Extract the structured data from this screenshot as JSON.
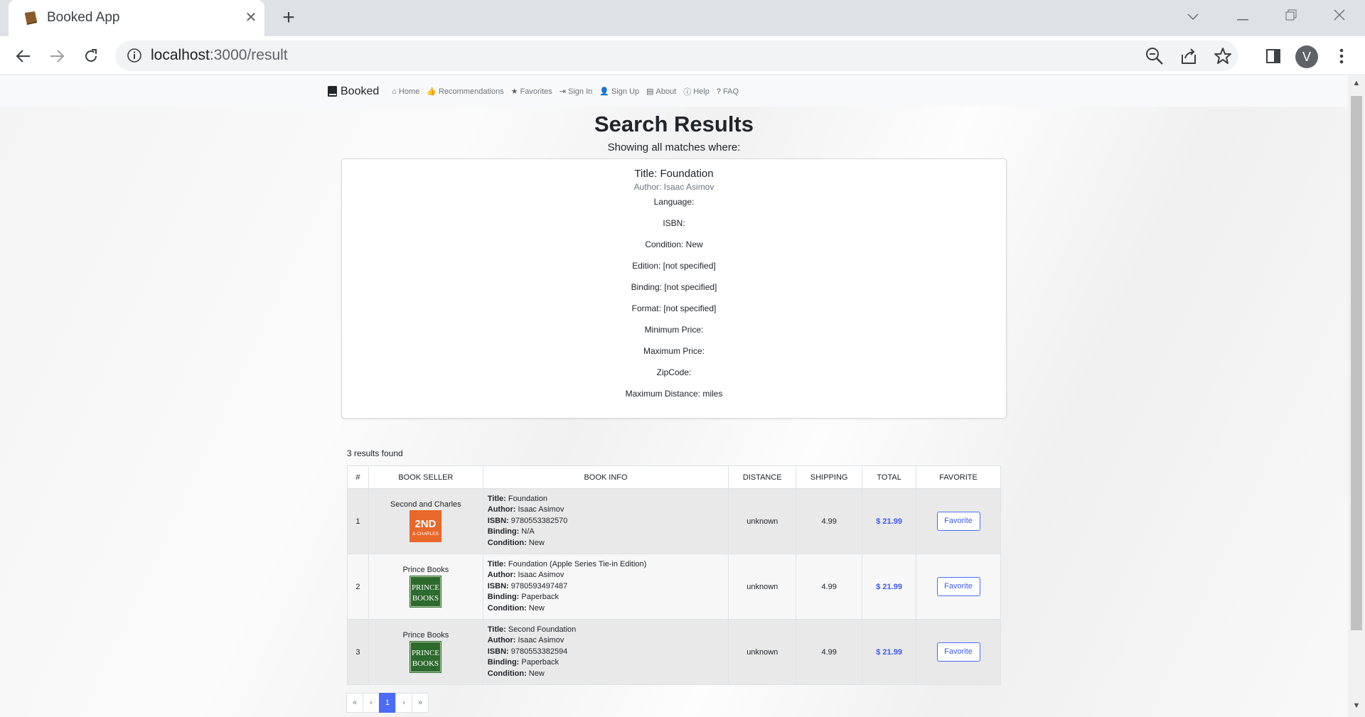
{
  "browser": {
    "tab_title": "Booked App",
    "url_host": "localhost",
    "url_rest": ":3000/result",
    "avatar_letter": "V"
  },
  "nav": {
    "brand": "Booked",
    "links": [
      {
        "label": "Home",
        "icon": "home-icon"
      },
      {
        "label": "Recommendations",
        "icon": "thumbs-up-icon"
      },
      {
        "label": "Favorites",
        "icon": "star-icon"
      },
      {
        "label": "Sign In",
        "icon": "sign-in-icon"
      },
      {
        "label": "Sign Up",
        "icon": "user-plus-icon"
      },
      {
        "label": "About",
        "icon": "id-card-icon"
      },
      {
        "label": "Help",
        "icon": "info-icon"
      },
      {
        "label": "FAQ",
        "icon": "question-icon"
      }
    ]
  },
  "page": {
    "title": "Search Results",
    "subtitle": "Showing all matches where:"
  },
  "criteria": {
    "title": "Title: Foundation",
    "author": "Author: Isaac Asimov",
    "rows": [
      "Language:",
      "ISBN:",
      "Condition: New",
      "Edition: [not specified]",
      "Binding: [not specified]",
      "Format: [not specified]",
      "Minimum Price:",
      "Maximum Price:",
      "ZipCode:",
      "Maximum Distance: miles"
    ]
  },
  "results": {
    "count_text": "3 results found",
    "headers": [
      "#",
      "BOOK SELLER",
      "BOOK INFO",
      "DISTANCE",
      "SHIPPING",
      "TOTAL",
      "FAVORITE"
    ],
    "info_labels": {
      "title": "Title:",
      "author": "Author:",
      "isbn": "ISBN:",
      "binding": "Binding:",
      "condition": "Condition:"
    },
    "rows": [
      {
        "num": "1",
        "seller": "Second and Charles",
        "logo": "second-and-charles-logo",
        "title": "Foundation",
        "author": "Isaac Asimov",
        "isbn": "9780553382570",
        "binding": "N/A",
        "condition": "New",
        "distance": "unknown",
        "shipping": "4.99",
        "total": "$ 21.99",
        "fav": "Favorite"
      },
      {
        "num": "2",
        "seller": "Prince Books",
        "logo": "prince-books-logo",
        "title": "Foundation (Apple Series Tie-in Edition)",
        "author": "Isaac Asimov",
        "isbn": "9780593497487",
        "binding": "Paperback",
        "condition": "New",
        "distance": "unknown",
        "shipping": "4.99",
        "total": "$ 21.99",
        "fav": "Favorite"
      },
      {
        "num": "3",
        "seller": "Prince Books",
        "logo": "prince-books-logo",
        "title": "Second Foundation",
        "author": "Isaac Asimov",
        "isbn": "9780553382594",
        "binding": "Paperback",
        "condition": "New",
        "distance": "unknown",
        "shipping": "4.99",
        "total": "$ 21.99",
        "fav": "Favorite"
      }
    ]
  },
  "logos": {
    "second_and_charles": {
      "line1": "2ND",
      "line2": "& CHARLES"
    },
    "prince_books": {
      "line1": "PRINCE",
      "line2": "BOOKS"
    }
  },
  "pager": {
    "first": "«",
    "prev": "‹",
    "current": "1",
    "next": "›",
    "last": "»"
  },
  "colors": {
    "accent": "#4a6cf7",
    "total": "#3d5af1",
    "sc_orange": "#e8672a",
    "prince_green": "#2d6a2d"
  }
}
